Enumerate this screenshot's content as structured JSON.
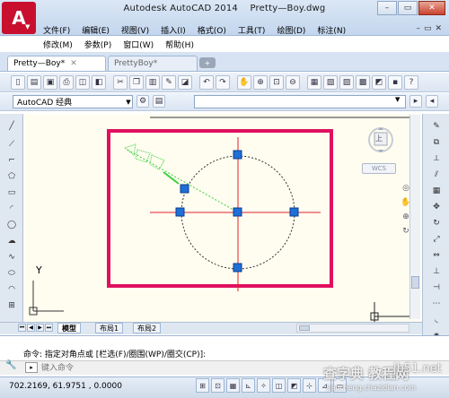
{
  "window": {
    "title": "Autodesk AutoCAD 2014",
    "document_name": "Pretty—Boy.dwg",
    "logo_letter": "A"
  },
  "menu": {
    "row1": [
      "文件(F)",
      "编辑(E)",
      "视图(V)",
      "插入(I)",
      "格式(O)",
      "工具(T)",
      "绘图(D)",
      "标注(N)"
    ],
    "row2": [
      "修改(M)",
      "参数(P)",
      "窗口(W)",
      "帮助(H)"
    ]
  },
  "tabs": [
    {
      "label": "Pretty—Boy*",
      "active": true
    },
    {
      "label": "PrettyBoy*",
      "active": false
    }
  ],
  "toolbar": {
    "workspace": "AutoCAD 经典"
  },
  "viewcube": {
    "face_label": "上",
    "wcs_label": "WCS"
  },
  "canvas": {
    "ucs_y_label": "Y",
    "selection_color": "#e0115f",
    "grip_color": "#1f6fd8",
    "centerline_color": "#e0202a",
    "dimension_color": "#3ccf3c"
  },
  "layout_tabs": [
    "模型",
    "布局1",
    "布局2"
  ],
  "command": {
    "history_line": "命令: 指定对角点或 [栏选(F)/圈围(WP)/圈交(CP)]:",
    "input_placeholder": "键入命令"
  },
  "status": {
    "coordinates": "702.2169, 61.9751 , 0.0000"
  },
  "watermark": {
    "site": "查字典 教程网",
    "brand": "jb51.net",
    "url": "jiaocheng.chazidian.com"
  }
}
